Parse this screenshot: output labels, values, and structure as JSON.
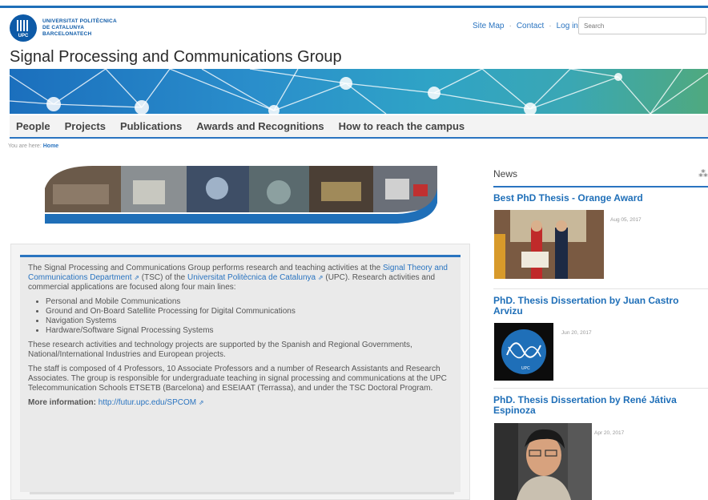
{
  "header": {
    "logo_lines": [
      "UNIVERSITAT POLITÈCNICA",
      "DE CATALUNYA",
      "BARCELONATECH"
    ],
    "logo_abbrev": "UPC",
    "links": [
      "Site Map",
      "Contact",
      "Log in"
    ],
    "search_placeholder": "Search",
    "site_title": "Signal Processing and Communications Group"
  },
  "nav": [
    "People",
    "Projects",
    "Publications",
    "Awards and Recognitions",
    "How to reach the campus"
  ],
  "breadcrumb": {
    "prefix": "You are here:",
    "home": "Home"
  },
  "main": {
    "intro_1": "The Signal Processing and Communications Group performs research and teaching activities at the",
    "link_tsc": "Signal Theory and Communications Department",
    "intro_2": "(TSC) of the",
    "link_upc": "Universitat Politècnica de Catalunya",
    "intro_3": "(UPC). Research activities and commercial applications are focused along four main lines:",
    "lines": [
      "Personal and Mobile Communications",
      "Ground and On-Board Satellite Processing for Digital Communications",
      "Navigation Systems",
      "Hardware/Software Signal Processing Systems"
    ],
    "para_2": "These research activities and technology projects are supported by the Spanish and Regional Governments, National/International Industries and European projects.",
    "para_3": "The staff is composed of 4 Professors, 10 Associate Professors and a number of Research Assistants and Research Associates. The group is responsible for undergraduate teaching in signal processing and communications at the UPC Telecommunication Schools ETSETB (Barcelona) and ESEIAAT (Terrassa), and under the TSC Doctoral Program.",
    "more_label": "More information:",
    "more_link": "http://futur.upc.edu/SPCOM"
  },
  "news": {
    "heading": "News",
    "items": [
      {
        "title": "Best PhD Thesis - Orange Award",
        "date": "Aug 05, 2017"
      },
      {
        "title": "PhD. Thesis Dissertation by Juan Castro Arvizu",
        "date": "Jun 20, 2017"
      },
      {
        "title": "PhD. Thesis Dissertation by René Játiva Espinoza",
        "date": "Apr 20, 2017"
      }
    ]
  },
  "colors": {
    "accent": "#2a74c0",
    "brand": "#0d5aa7"
  }
}
